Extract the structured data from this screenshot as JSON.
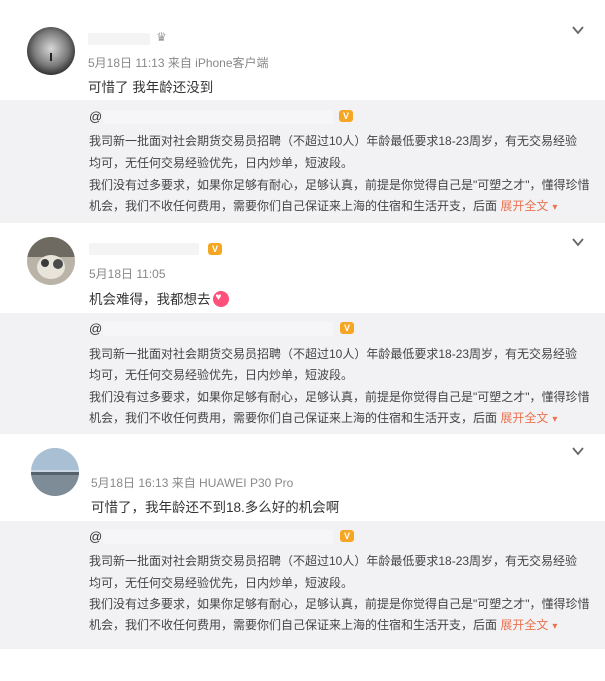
{
  "posts": [
    {
      "meta": "5月18日 11:13 来自 iPhone客户端",
      "text": "可惜了 我年龄还没到",
      "quote": {
        "name": "@",
        "line1": "我司新一批面对社会期货交易员招聘（不超过10人）年龄最低要求18-23周岁，有无交易经验",
        "line2": "均可，无任何交易经验优先，日内炒单，短波段。",
        "line3": "我们没有过多要求，如果你足够有耐心，足够认真，前提是你觉得自己是\"可塑之才\"，懂得珍惜",
        "line4": "机会，我们不收任何费用，需要你们自己保证来上海的住宿和生活开支，后面",
        "expand": "展开全文"
      }
    },
    {
      "meta": "5月18日 11:05",
      "text": "机会难得，我都想去",
      "quote": {
        "name": "@",
        "line1": "我司新一批面对社会期货交易员招聘（不超过10人）年龄最低要求18-23周岁，有无交易经验",
        "line2": "均可，无任何交易经验优先，日内炒单，短波段。",
        "line3": "我们没有过多要求，如果你足够有耐心，足够认真，前提是你觉得自己是\"可塑之才\"，懂得珍惜",
        "line4": "机会，我们不收任何费用，需要你们自己保证来上海的住宿和生活开支，后面",
        "expand": "展开全文"
      }
    },
    {
      "meta": "5月18日 16:13 来自 HUAWEI P30 Pro",
      "text": "可惜了，我年龄还不到18.多么好的机会啊",
      "quote": {
        "name": "@",
        "line1": "我司新一批面对社会期货交易员招聘（不超过10人）年龄最低要求18-23周岁，有无交易经验",
        "line2": "均可，无任何交易经验优先，日内炒单，短波段。",
        "line3": "我们没有过多要求，如果你足够有耐心，足够认真，前提是你觉得自己是\"可塑之才\"，懂得珍惜",
        "line4": "机会，我们不收任何费用，需要你们自己保证来上海的住宿和生活开支，后面",
        "expand": "展开全文"
      }
    }
  ],
  "icons": {
    "chevron": "chevron-down-icon",
    "badge": "vip-badge-icon",
    "emoji": "heart-eyes-emoji-icon"
  },
  "colors": {
    "expand_link": "#eb7350",
    "badge": "#f5a623",
    "quote_bg": "#f2f2f5"
  }
}
